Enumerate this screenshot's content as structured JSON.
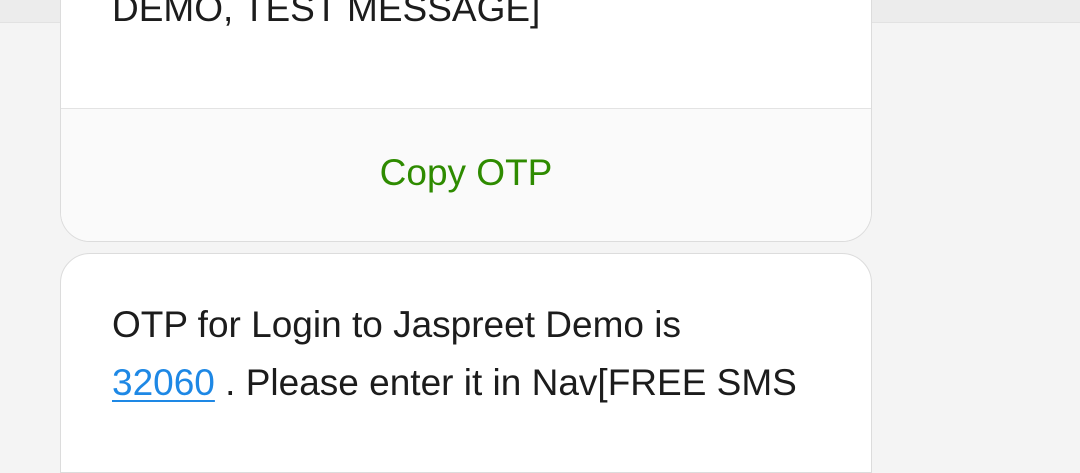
{
  "messages": [
    {
      "body_text": "DEMO, TEST MESSAGE]",
      "action_label": "Copy OTP"
    },
    {
      "line1": "OTP for Login to Jaspreet Demo is",
      "otp_code": "32060",
      "line2_suffix": " . Please enter it in Nav[FREE SMS"
    }
  ],
  "colors": {
    "action": "#2e8b00",
    "link": "#1e88e5"
  }
}
